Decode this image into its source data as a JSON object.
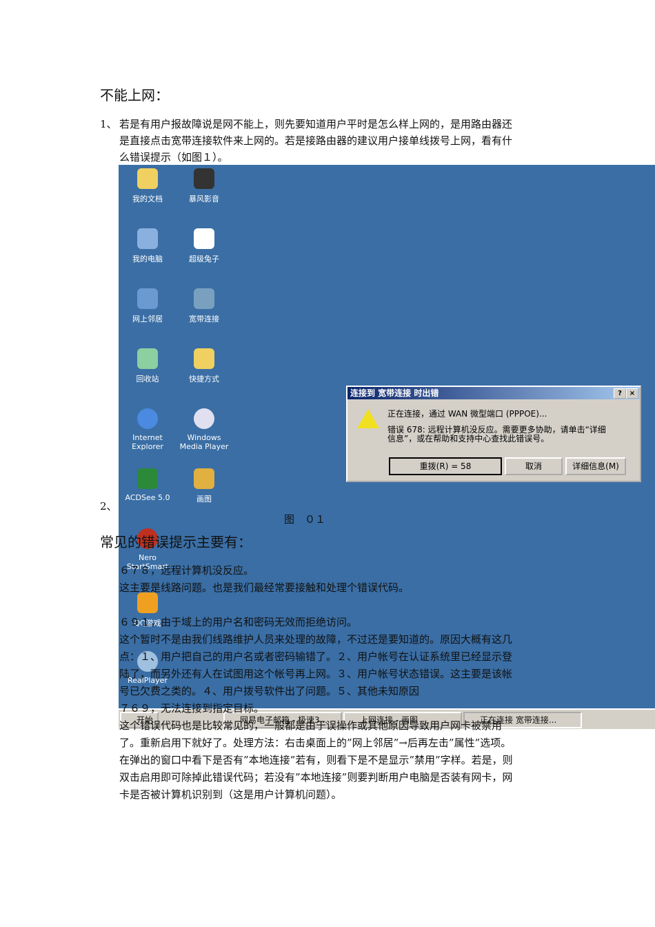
{
  "heading": "不能上网：",
  "para1": {
    "num": "1、",
    "lines": [
      "若是有用户报故障说是网不能上，则先要知道用户平时是怎么样上网的，是用路由器还",
      "是直接点击宽带连接软件来上网的。若是接路由器的建议用户接单线拨号上网，看有什",
      "么错误提示（如图１）。"
    ]
  },
  "desktop": {
    "icons": [
      "我的文档",
      "暴风影音",
      "我的电脑",
      "超级兔子",
      "网上邻居",
      "宽带连接",
      "回收站",
      "快捷方式",
      "Internet Explorer",
      "Windows Media Player",
      "ACDSee 5.0",
      "画图",
      "Nero StartSmart",
      "QQ游戏",
      "RealPlayer"
    ],
    "dialog": {
      "title": "连接到 宽带连接 时出错",
      "help": "?",
      "close": "×",
      "status": "正在连接，通过 WAN 微型端口 (PPPOE)...",
      "error": [
        "错误 678: 远程计算机没反应。需要更多协助，请单击“详细",
        "信息”，或在帮助和支持中心查找此错误号。"
      ],
      "redial": "重拨(R) = 58",
      "cancel": "取消",
      "details": "详细信息(M)"
    },
    "taskbar": {
      "start": "开始",
      "tasks": [
        "网易电子邮箱 - 极速3...",
        "上网连接 - 画图",
        "正在连接 宽带连接..."
      ]
    }
  },
  "num2": "2、",
  "caption": "图　０１",
  "heading2": "常见的错误提示主要有：",
  "body": [
    "６７８，远程计算机没反应。",
    "这主要是线路问题。也是我们最经常要接触和处理个错误代码。",
    "６９１，由于域上的用户名和密码无效而拒绝访问。",
    "这个暂时不是由我们线路维护人员来处理的故障，不过还是要知道的。原因大概有这几",
    "点：１、用户把自己的用户名或者密码输错了。２、用户帐号在认证系统里已经显示登",
    "陆了，而另外还有人在试图用这个帐号再上网。３、用户帐号状态错误。这主要是该帐",
    "号已欠费之类的。４、用户拨号软件出了问题。５、其他未知原因",
    "７６９，无法连接到指定目标。",
    "这个错误代码也是比较常见的，一般都是由于误操作或其他原因导致用户网卡被禁用",
    "了。重新启用下就好了。处理方法：右击桌面上的”网上邻居”→后再左击”属性”选项。",
    "在弹出的窗口中看下是否有”本地连接”若有，则看下是不是显示”禁用”字样。若是，则",
    "双击启用即可除掉此错误代码；若没有”本地连接”则要判断用户电脑是否装有网卡，网",
    "卡是否被计算机识别到（这是用户计算机问题）。"
  ]
}
